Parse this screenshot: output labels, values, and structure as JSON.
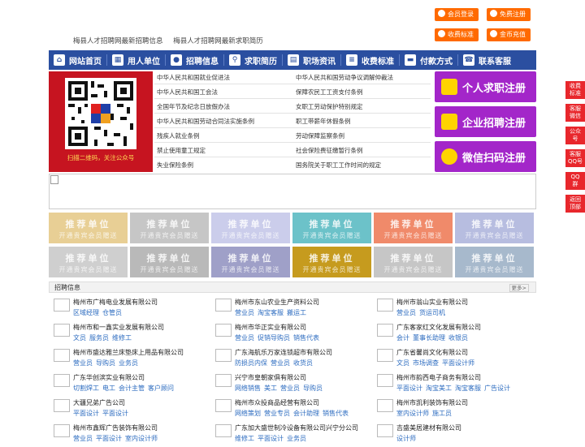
{
  "top_buttons": {
    "member_login": "会员登录",
    "free_register": "免费注册",
    "fee_standard": "收费标准",
    "coin_recharge": "金币充值"
  },
  "top_links": [
    "梅县人才招聘网最新招聘信息",
    "梅县人才招聘网最新求职简历"
  ],
  "nav": [
    "网站首页",
    "用人单位",
    "招聘信息",
    "求职简历",
    "职场资讯",
    "收费标准",
    "付款方式",
    "联系客服"
  ],
  "qr_caption": "扫描二维码，关注公众号",
  "laws_left": [
    "中华人民共和国就业促进法",
    "中华人民共和国工会法",
    "全国年节及纪念日放假办法",
    "中华人民共和国劳动合同法实施条例",
    "残疾人就业条例",
    "禁止使用童工规定",
    "失业保险条例"
  ],
  "laws_right": [
    "中华人民共和国劳动争议调解仲裁法",
    "保障农民工工资支付条例",
    "女职工劳动保护特别规定",
    "职工带薪年休假条例",
    "劳动保障监察条例",
    "社会保险费征缴暂行条例",
    "国务院关于职工工作时间的规定"
  ],
  "reg_buttons": {
    "seeker": "个人求职注册",
    "employer": "企业招聘注册",
    "wechat": "微信扫码注册"
  },
  "side_float": [
    "收费\n标准",
    "客服\n微信",
    "公众\n号",
    "客服\nQQ号",
    "QQ\n群",
    "返回\n顶部"
  ],
  "recommend": {
    "title": "推荐单位",
    "sub": "开通贵宾会员赠送",
    "colors": [
      "#e8cf95",
      "#c6c6c6",
      "#cbcdeb",
      "#6cc2c9",
      "#f08a6a",
      "#b7bde0",
      "#cfcfcf",
      "#b9b9b9",
      "#9fa0c8",
      "#c69b1e",
      "#c6c6c6",
      "#a7b9cc",
      "#8fa6d6",
      "#c7cae6"
    ]
  },
  "section": {
    "title": "招聘信息",
    "more": "更多>"
  },
  "jobs": [
    [
      {
        "company": "梅州市广梅电业发展有限公司",
        "tags": [
          "区域经理",
          "仓管员"
        ]
      },
      {
        "company": "梅州市和一鑫实业发展有限公司",
        "tags": [
          "文员",
          "服务员",
          "维修工"
        ]
      },
      {
        "company": "梅州市盛达雅兰床垫床上用品有限公司",
        "tags": [
          "营业员",
          "导购员",
          "业务员"
        ]
      },
      {
        "company": "广东华创滨实业有限公司",
        "tags": [
          "切割焊工",
          "电工",
          "会计主管",
          "客户顾问"
        ]
      },
      {
        "company": "大疆兄弟广告公司",
        "tags": [
          "平面设计",
          "平面设计"
        ]
      },
      {
        "company": "梅州市鑫辉广告装饰有限公司",
        "tags": [
          "营业员",
          "平面设计",
          "室内设计师"
        ]
      }
    ],
    [
      {
        "company": "梅州市东山农业生产资料公司",
        "tags": [
          "营业员",
          "淘宝客服",
          "搬运工"
        ]
      },
      {
        "company": "梅州市华正实业有限公司",
        "tags": [
          "营业员",
          "促销导购员",
          "销售代表"
        ]
      },
      {
        "company": "广东海航乐万家连锁超市有限公司",
        "tags": [
          "防损员内保",
          "营业员",
          "收货员"
        ]
      },
      {
        "company": "兴宁市皇朝家俱有限公司",
        "tags": [
          "网络销售",
          "美工",
          "营业员",
          "导购员"
        ]
      },
      {
        "company": "梅州市众投商品经营有限公司",
        "tags": [
          "网络策划",
          "营业专员",
          "会计助理",
          "销售代表"
        ]
      },
      {
        "company": "广东加大盛世制冷设备有限公司兴宁分公司",
        "tags": [
          "维修工",
          "平面设计",
          "业务员"
        ]
      }
    ],
    [
      {
        "company": "梅州市翁山实业有限公司",
        "tags": [
          "营业员",
          "货运司机"
        ]
      },
      {
        "company": "广东客家红文化发展有限公司",
        "tags": [
          "会计",
          "董事长助理",
          "收银员"
        ]
      },
      {
        "company": "广东省馨尚文化有限公司",
        "tags": [
          "文员",
          "市场调查",
          "平面设计师"
        ]
      },
      {
        "company": "梅州市韵西电子商务有限公司",
        "tags": [
          "平面设计",
          "淘宝美工",
          "淘宝客服",
          "广告设计"
        ]
      },
      {
        "company": "梅州市凯利装饰有限公司",
        "tags": [
          "室内设计师",
          "施工员"
        ]
      },
      {
        "company": "吉盛美居建材有限公司",
        "tags": [
          "设计师"
        ]
      }
    ]
  ]
}
